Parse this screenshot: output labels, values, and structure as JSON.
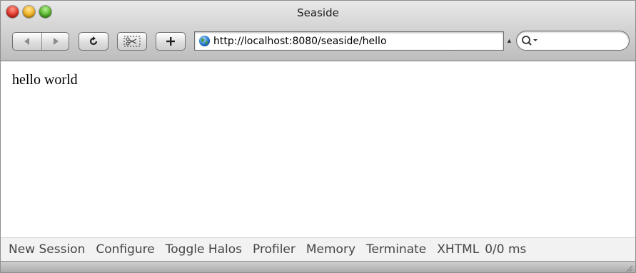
{
  "window": {
    "title": "Seaside"
  },
  "toolbar": {
    "back_icon": "back-arrow-icon",
    "forward_icon": "forward-arrow-icon",
    "reload_glyph": "c",
    "add_glyph": "+",
    "snip_icon": "snippet-icon"
  },
  "address_bar": {
    "url": "http://localhost:8080/seaside/hello",
    "icon": "globe-icon"
  },
  "search": {
    "icon": "magnifier-icon",
    "placeholder": ""
  },
  "page": {
    "text": "hello world"
  },
  "seaside_toolbar": {
    "items": [
      "New Session",
      "Configure",
      "Toggle Halos",
      "Profiler",
      "Memory",
      "Terminate",
      "XHTML"
    ],
    "timing": "0/0 ms"
  },
  "colors": {
    "close": "#e0382a",
    "minimize": "#f2b320",
    "zoom": "#55b62a"
  }
}
